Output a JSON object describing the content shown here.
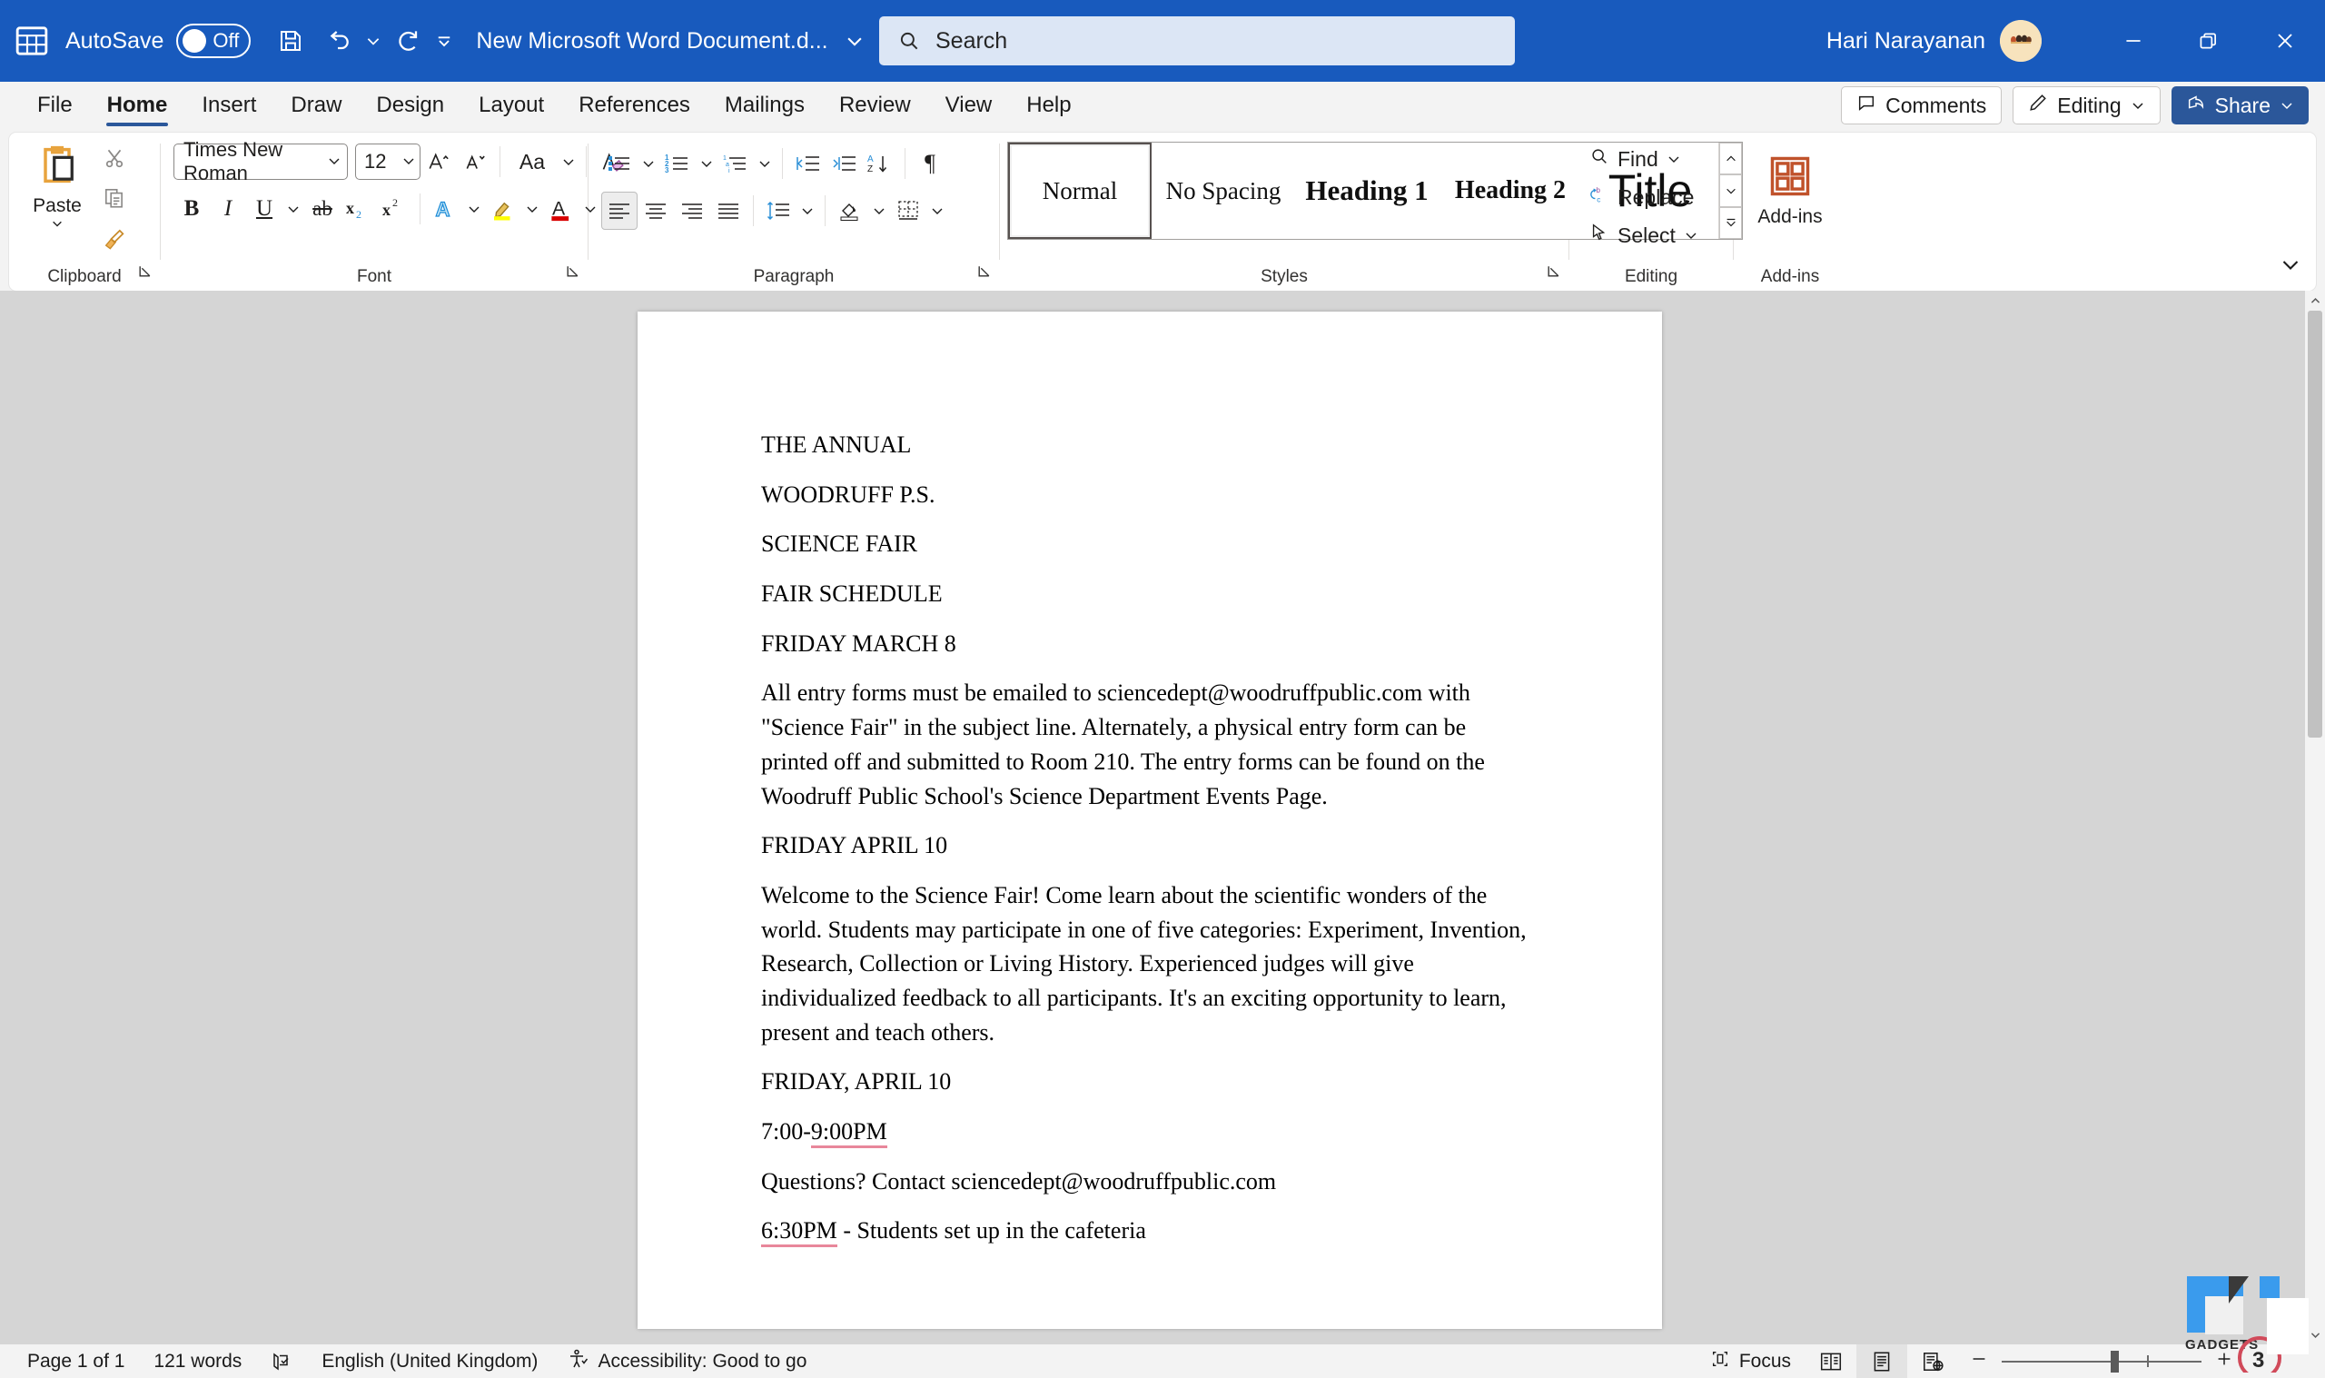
{
  "titlebar": {
    "app_icon": "word-logo-icon",
    "autosave_label": "AutoSave",
    "autosave_state": "Off",
    "save_icon": "save-icon",
    "undo_icon": "undo-icon",
    "redo_icon": "redo-icon",
    "qat_more_icon": "qat-overflow-icon",
    "document_title": "New Microsoft Word Document.d...",
    "title_dropdown_icon": "chevron-down-icon",
    "account_name": "Hari Narayanan",
    "minimize_icon": "minimize-icon",
    "restore_icon": "restore-icon",
    "close_icon": "close-icon",
    "brand_color": "#185ABD"
  },
  "search": {
    "placeholder": "Search",
    "icon": "search-icon"
  },
  "tabs": [
    {
      "label": "File",
      "active": false
    },
    {
      "label": "Home",
      "active": true
    },
    {
      "label": "Insert",
      "active": false
    },
    {
      "label": "Draw",
      "active": false
    },
    {
      "label": "Design",
      "active": false
    },
    {
      "label": "Layout",
      "active": false
    },
    {
      "label": "References",
      "active": false
    },
    {
      "label": "Mailings",
      "active": false
    },
    {
      "label": "Review",
      "active": false
    },
    {
      "label": "View",
      "active": false
    },
    {
      "label": "Help",
      "active": false
    }
  ],
  "tab_actions": {
    "comments_label": "Comments",
    "comments_icon": "comment-icon",
    "editing_label": "Editing",
    "editing_icon": "pencil-icon",
    "editing_caret_icon": "chevron-down-icon",
    "share_label": "Share",
    "share_icon": "share-icon",
    "share_caret_icon": "chevron-down-icon",
    "share_color": "#2b579a"
  },
  "ribbon": {
    "clipboard": {
      "group_label": "Clipboard",
      "paste_label": "Paste",
      "paste_icon": "paste-icon",
      "paste_caret_icon": "chevron-down-icon",
      "cut_icon": "scissors-icon",
      "copy_icon": "copy-icon",
      "format_painter_icon": "format-painter-icon",
      "launcher_icon": "dialog-launcher-icon"
    },
    "font": {
      "group_label": "Font",
      "font_name": "Times New Roman",
      "font_size": "12",
      "grow_font_icon": "grow-font-icon",
      "shrink_font_icon": "shrink-font-icon",
      "change_case_icon": "change-case-icon",
      "clear_formatting_icon": "clear-formatting-icon",
      "bold_label": "B",
      "italic_label": "I",
      "underline_label": "U",
      "strikethrough_label": "ab",
      "subscript_label": "x",
      "superscript_label": "x",
      "text_effects_icon": "text-effects-icon",
      "highlight_icon": "highlight-color-icon",
      "font_color_icon": "font-color-icon",
      "highlight_color": "#ffff00",
      "font_color": "#d80000",
      "launcher_icon": "dialog-launcher-icon"
    },
    "paragraph": {
      "group_label": "Paragraph",
      "bullets_icon": "bullets-icon",
      "numbering_icon": "numbering-icon",
      "multilevel_icon": "multilevel-list-icon",
      "decrease_indent_icon": "decrease-indent-icon",
      "increase_indent_icon": "increase-indent-icon",
      "sort_icon": "sort-az-icon",
      "show_marks_icon": "paragraph-marks-icon",
      "align_left_icon": "align-left-icon",
      "align_center_icon": "align-center-icon",
      "align_right_icon": "align-right-icon",
      "justify_icon": "justify-icon",
      "line_spacing_icon": "line-spacing-icon",
      "shading_icon": "shading-icon",
      "borders_icon": "borders-icon",
      "launcher_icon": "dialog-launcher-icon"
    },
    "styles": {
      "group_label": "Styles",
      "items": [
        {
          "label": "Normal",
          "selected": true
        },
        {
          "label": "No Spacing",
          "selected": false
        },
        {
          "label": "Heading 1",
          "selected": false
        },
        {
          "label": "Heading 2",
          "selected": false
        },
        {
          "label": "Title",
          "selected": false
        }
      ],
      "scroll_up_icon": "chevron-up-icon",
      "scroll_down_icon": "chevron-down-icon",
      "more_icon": "styles-more-icon",
      "launcher_icon": "dialog-launcher-icon"
    },
    "editing": {
      "group_label": "Editing",
      "find_label": "Find",
      "find_icon": "search-icon",
      "find_caret_icon": "chevron-down-icon",
      "replace_label": "Replace",
      "replace_icon": "replace-icon",
      "select_label": "Select",
      "select_icon": "cursor-arrow-icon",
      "select_caret_icon": "chevron-down-icon"
    },
    "addins": {
      "group_label": "Add-ins",
      "button_label": "Add-ins",
      "icon": "addins-grid-icon"
    },
    "collapse_icon": "chevron-down-icon"
  },
  "document": {
    "paragraphs": [
      {
        "text": "THE ANNUAL",
        "type": "line"
      },
      {
        "text": "WOODRUFF P.S.",
        "type": "line"
      },
      {
        "text": "SCIENCE FAIR",
        "type": "line"
      },
      {
        "text": "FAIR SCHEDULE",
        "type": "line"
      },
      {
        "text": "FRIDAY MARCH 8",
        "type": "line"
      },
      {
        "text": "All entry forms must be emailed to sciencedept@woodruffpublic.com with \"Science Fair\" in the subject line. Alternately, a physical entry form can be printed off and submitted to Room 210. The entry forms can be found on the Woodruff Public School's Science Department Events Page.",
        "type": "body"
      },
      {
        "text": "FRIDAY APRIL 10",
        "type": "line"
      },
      {
        "text": "Welcome to the Science Fair! Come learn about the scientific wonders of the world. Students may participate in one of five categories: Experiment, Invention, Research, Collection or Living History. Experienced judges will give individualized feedback to all participants. It's an exciting opportunity to learn, present and teach others.",
        "type": "body"
      },
      {
        "text": "FRIDAY, APRIL 10",
        "type": "line"
      },
      {
        "text": "7:00-9:00PM",
        "type": "line",
        "spell_error": "9:00PM"
      },
      {
        "text": "Questions? Contact sciencedept@woodruffpublic.com",
        "type": "line"
      },
      {
        "text": "6:30PM - Students set up in the cafeteria",
        "type": "line",
        "spell_error": "6:30PM"
      }
    ]
  },
  "statusbar": {
    "page_info": "Page 1 of 1",
    "word_count": "121 words",
    "proofing_icon": "proofing-icon",
    "language": "English (United Kingdom)",
    "accessibility_icon": "accessibility-icon",
    "accessibility": "Accessibility: Good to go",
    "focus_label": "Focus",
    "focus_icon": "focus-icon",
    "read_mode_icon": "read-mode-icon",
    "print_layout_icon": "print-layout-icon",
    "web_layout_icon": "web-layout-icon",
    "zoom_out_icon": "zoom-out-icon",
    "zoom_in_icon": "zoom-in-icon",
    "zoom_level": ""
  },
  "watermark": {
    "text": "GADGETS",
    "badge": "3"
  }
}
